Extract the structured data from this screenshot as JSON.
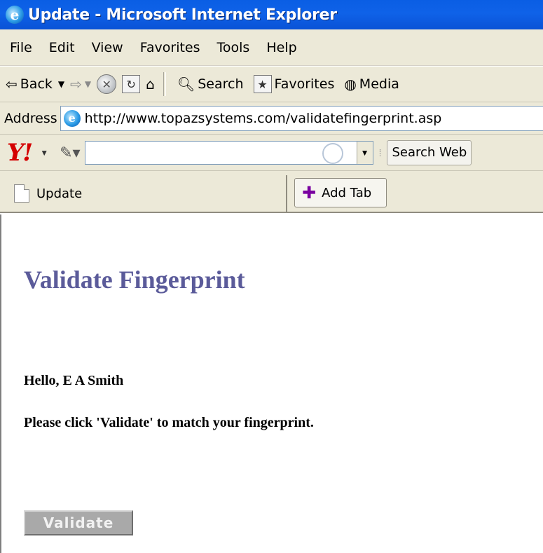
{
  "window": {
    "title": "Update - Microsoft Internet Explorer"
  },
  "menu": [
    "File",
    "Edit",
    "View",
    "Favorites",
    "Tools",
    "Help"
  ],
  "toolbar": {
    "back_label": "Back",
    "search_label": "Search",
    "favorites_label": "Favorites",
    "media_label": "Media"
  },
  "address": {
    "label": "Address",
    "url": "http://www.topazsystems.com/validatefingerprint.asp"
  },
  "yahoo": {
    "logo": "Y!",
    "search_value": "",
    "search_button_label": "Search Web"
  },
  "tabs": {
    "active_label": "Update",
    "add_label": "Add Tab"
  },
  "page": {
    "heading": "Validate Fingerprint",
    "greeting": "Hello, E A Smith",
    "instruction": "Please click 'Validate' to match your fingerprint.",
    "validate_label": "Validate"
  },
  "colors": {
    "titlebar": "#0a5ee4",
    "chrome": "#ece9d8",
    "heading": "#5b5b9a",
    "validate_bg": "#a9a9a9"
  }
}
